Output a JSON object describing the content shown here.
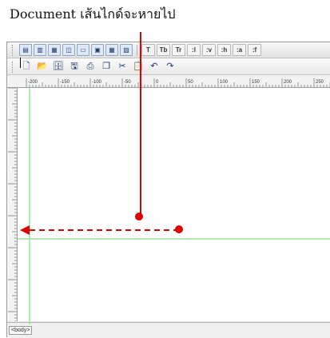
{
  "caption": "Document เส้นไกด์จะหายไป",
  "toolbar1": {
    "buttons": [
      {
        "icon": "view-code-icon",
        "label": ""
      },
      {
        "icon": "view-split-icon",
        "label": ""
      },
      {
        "icon": "view-design-icon",
        "label": ""
      },
      {
        "icon": "preview-icon",
        "label": ""
      },
      {
        "icon": "layer-icon",
        "label": ""
      },
      {
        "icon": "frame-icon",
        "label": ""
      },
      {
        "icon": "table-icon",
        "label": ""
      },
      {
        "icon": "image-icon",
        "label": ""
      }
    ],
    "text_buttons": [
      "T",
      "Tb",
      "Tr",
      ":l",
      ":v",
      ":h",
      ":a",
      ":f"
    ]
  },
  "toolbar2": {
    "buttons": [
      "new-icon",
      "open-icon",
      "save-icon",
      "save-all-icon",
      "print-icon",
      "copy-icon",
      "cut-icon",
      "paste-icon",
      "undo-icon",
      "redo-icon"
    ]
  },
  "ruler": {
    "labels": [
      "-200",
      "-150",
      "-100",
      "-50",
      "0",
      "50",
      "100",
      "150",
      "200",
      "250"
    ]
  },
  "status_tag": "<body>",
  "colors": {
    "arrow": "#e00000",
    "guide": "#7fe07f",
    "dashed": "#e00000"
  }
}
